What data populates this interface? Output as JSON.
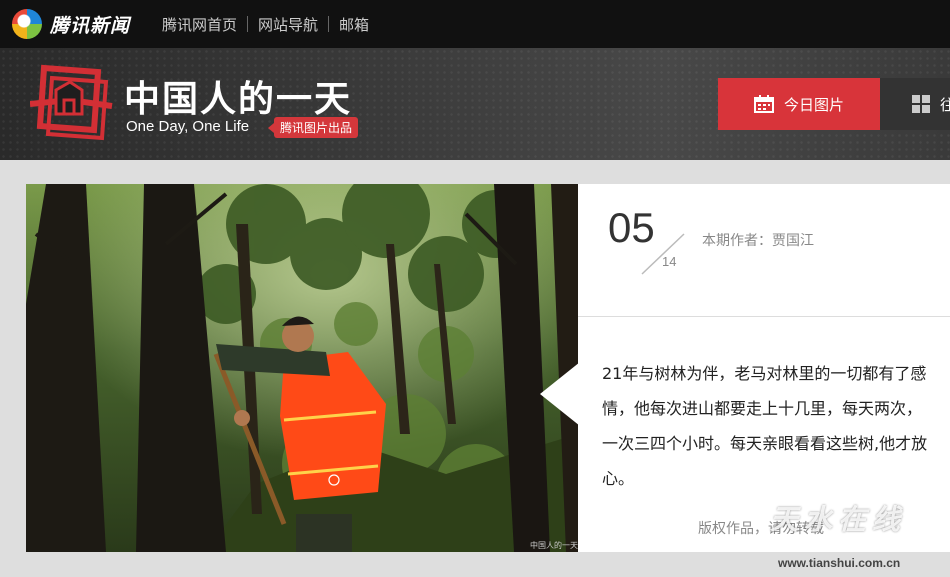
{
  "topbar": {
    "brand_name": "腾讯新闻",
    "nav": [
      "腾讯网首页",
      "网站导航",
      "邮箱"
    ]
  },
  "banner": {
    "title": "中国人的一天",
    "subtitle": "One Day, One Life",
    "badge": "腾讯图片出品",
    "today_button": "今日图片",
    "past_button": "往"
  },
  "issue": {
    "day": "05",
    "month": "14",
    "author_label": "本期作者：贾国江"
  },
  "description": "21年与树林为伴，老马对林里的一切都有了感情，他每次进山都要走上十几里，每天两次，一次三四个小时。每天亲眼看看这些树,他才放心。",
  "copyright": "版权作品，请勿转载",
  "photo_credit": "中国人的一天",
  "watermark": {
    "text": "天水在线",
    "url": "www.tianshui.com.cn"
  },
  "colors": {
    "accent": "#d8343a",
    "topbar": "#111111",
    "banner": "#3a3a3a"
  }
}
